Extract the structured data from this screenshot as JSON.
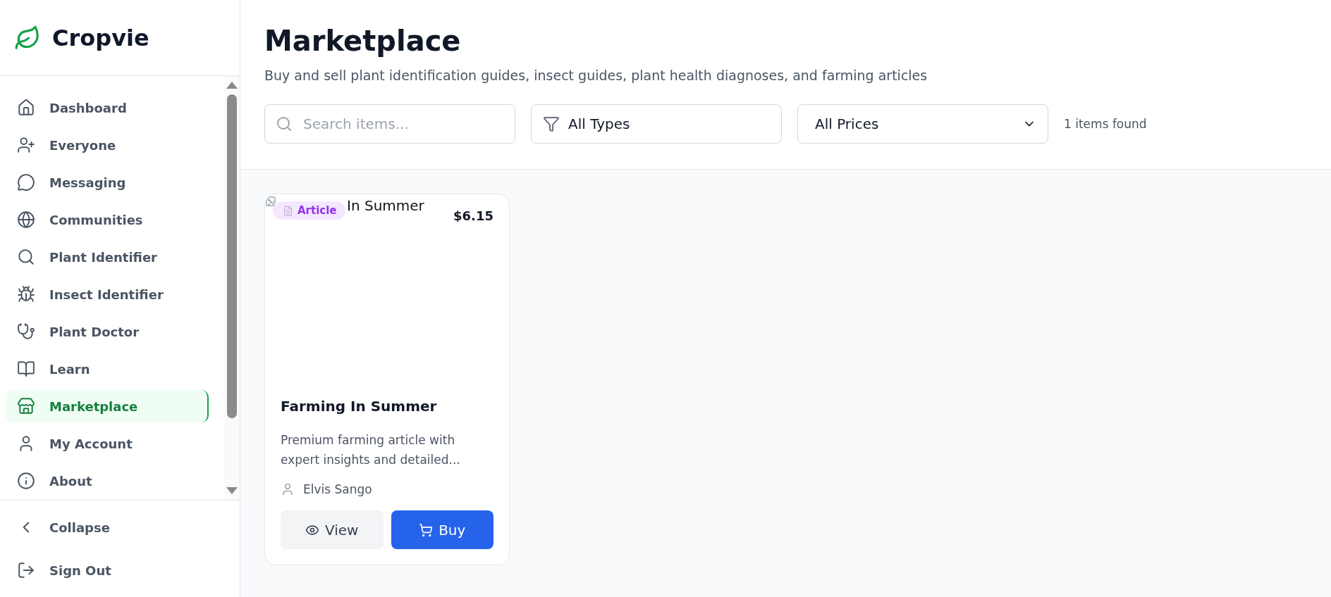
{
  "brand": "Cropvie",
  "nav": [
    {
      "label": "Dashboard",
      "selected": false
    },
    {
      "label": "Everyone",
      "selected": false
    },
    {
      "label": "Messaging",
      "selected": false
    },
    {
      "label": "Communities",
      "selected": false
    },
    {
      "label": "Plant Identifier",
      "selected": false
    },
    {
      "label": "Insect Identifier",
      "selected": false
    },
    {
      "label": "Plant Doctor",
      "selected": false
    },
    {
      "label": "Learn",
      "selected": false
    },
    {
      "label": "Marketplace",
      "selected": true
    },
    {
      "label": "My Account",
      "selected": false
    },
    {
      "label": "About",
      "selected": false
    }
  ],
  "footer_nav": [
    "Collapse",
    "Sign Out"
  ],
  "header": {
    "title": "Marketplace",
    "subtitle": "Buy and sell plant identification guides, insect guides, plant health diagnoses, and farming articles"
  },
  "filters": {
    "search": {
      "placeholder": "Search items..."
    },
    "type": "All Types",
    "price": "All Prices",
    "count": "1 items found"
  },
  "items": [
    {
      "image_alt": "In Summer",
      "badge": "Article",
      "price": "$6.15",
      "title": "Farming In Summer",
      "description": "Premium farming article with expert insights and detailed...",
      "author": "Elvis Sango",
      "actions": [
        "View",
        "Buy"
      ]
    }
  ]
}
